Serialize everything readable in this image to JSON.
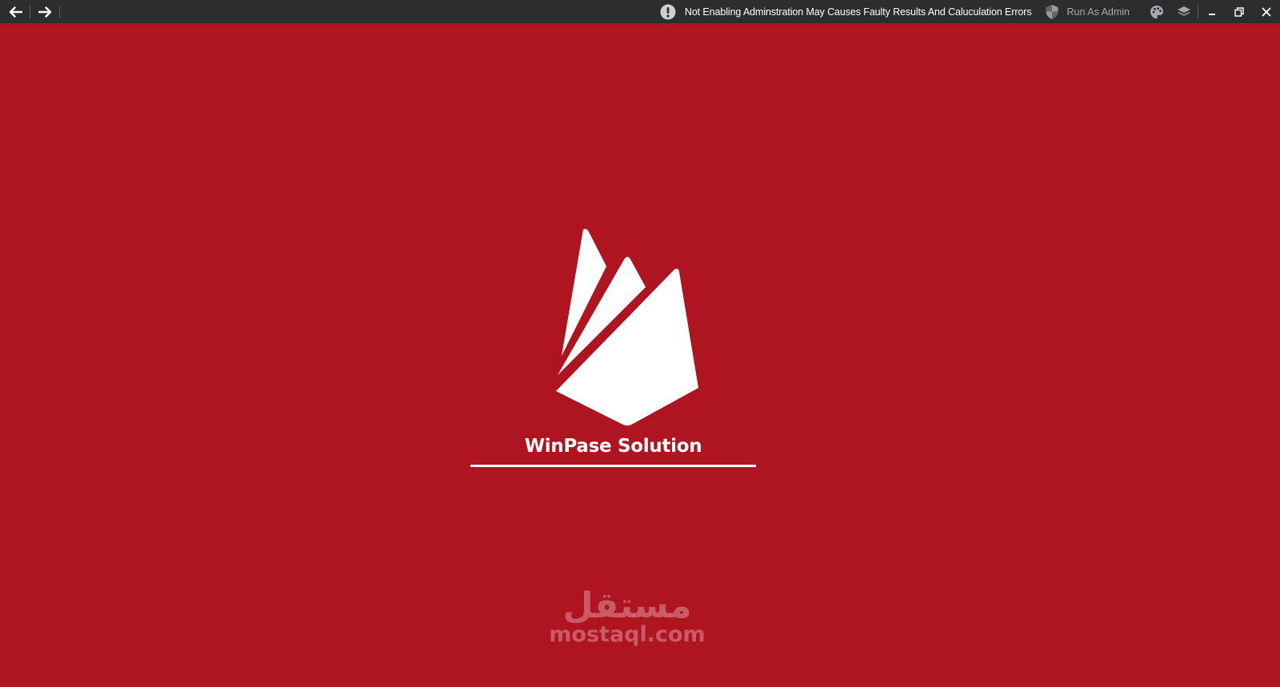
{
  "titlebar": {
    "back_icon": "arrow-left-icon",
    "forward_icon": "arrow-right-icon",
    "warning_icon": "exclamation-circle-icon",
    "warning_text": "Not Enabling Adminstration May Causes Faulty Results And Caluculation Errors",
    "admin_icon": "shield-icon",
    "admin_label": "Run As Admin",
    "theme_icon": "palette-icon",
    "layers_icon": "layers-icon",
    "minimize_icon": "minimize-icon",
    "restore_icon": "restore-icon",
    "close_icon": "close-icon"
  },
  "splash": {
    "logo_icon": "firebase-flame-logo",
    "title": "WinPase Solution",
    "progress": 1.0
  },
  "watermark": {
    "arabic": "مستقل",
    "latin": "mostaql.com"
  },
  "colors": {
    "background": "#ae1521",
    "titlebar": "#2d2d30",
    "foreground": "#ffffff",
    "muted_text": "#a8a8ac"
  }
}
